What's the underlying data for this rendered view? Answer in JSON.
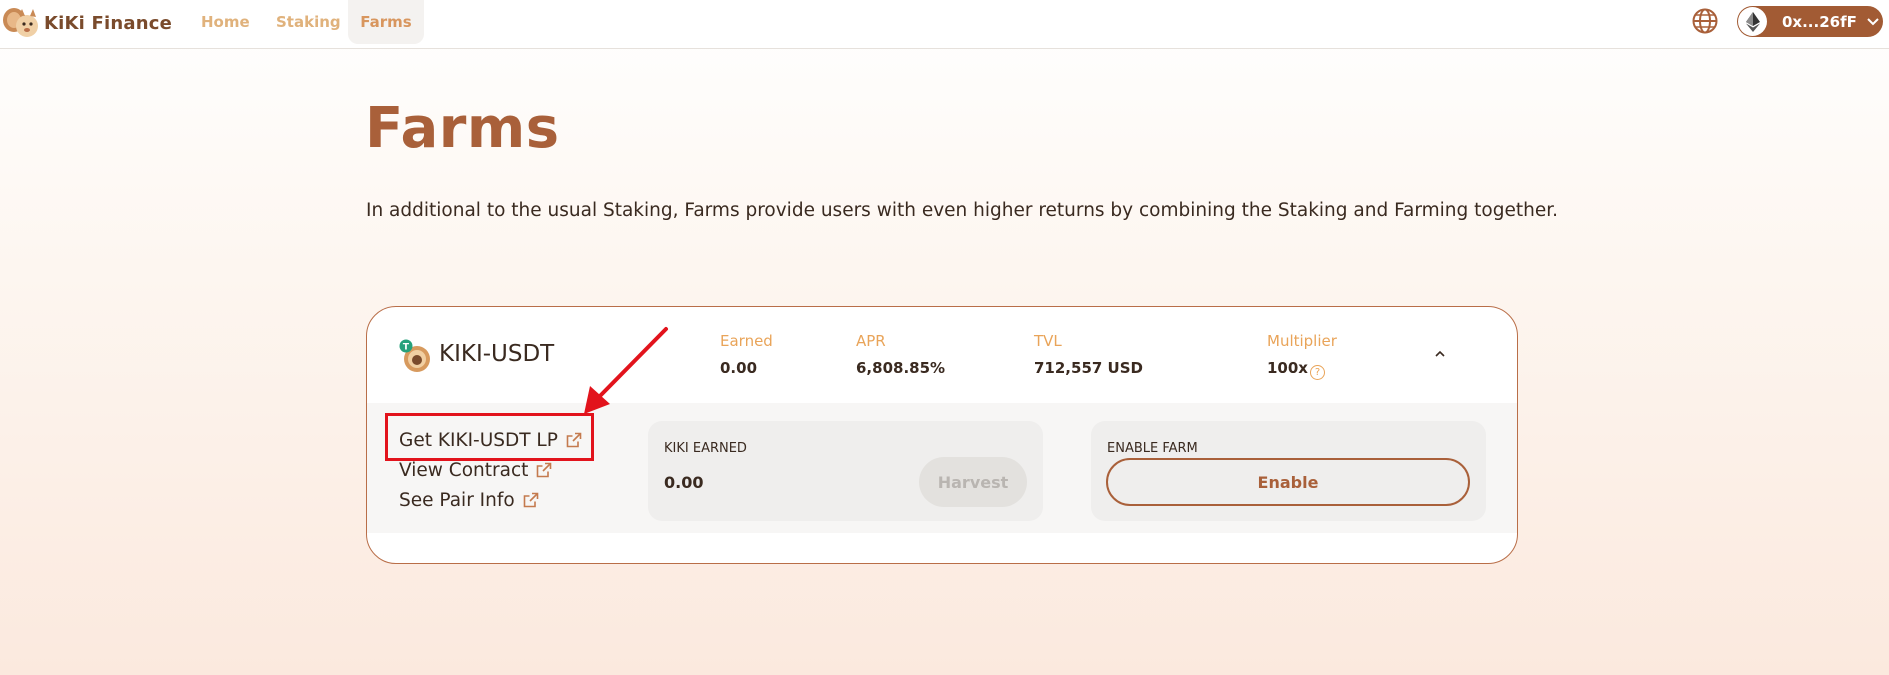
{
  "header": {
    "brand": "KiKi Finance",
    "nav": [
      {
        "label": "Home"
      },
      {
        "label": "Staking"
      },
      {
        "label": "Farms",
        "active": true
      }
    ],
    "language_icon": "globe-icon",
    "wallet": {
      "address": "0x...26fF",
      "network_icon": "ethereum-icon"
    }
  },
  "page": {
    "title": "Farms",
    "description": "In additional to the usual Staking, Farms provide users with even higher returns by combining the Staking and Farming together."
  },
  "farm": {
    "pair": "KIKI-USDT",
    "stats": {
      "earned": {
        "label": "Earned",
        "value": "0.00"
      },
      "apr": {
        "label": "APR",
        "value": "6,808.85%"
      },
      "tvl": {
        "label": "TVL",
        "value": "712,557 USD"
      },
      "multiplier": {
        "label": "Multiplier",
        "value": "100x"
      }
    },
    "links": [
      {
        "label": "Get KIKI-USDT LP"
      },
      {
        "label": "View Contract"
      },
      {
        "label": "See Pair Info"
      }
    ],
    "earned_panel": {
      "label": "KIKI EARNED",
      "value": "0.00",
      "button": "Harvest"
    },
    "enable_panel": {
      "label": "ENABLE FARM",
      "button": "Enable"
    }
  },
  "colors": {
    "brand": "#a9603a",
    "nav_text": "#e0b27c",
    "stat_label": "#e9a459",
    "annotation": "#e2131c"
  }
}
